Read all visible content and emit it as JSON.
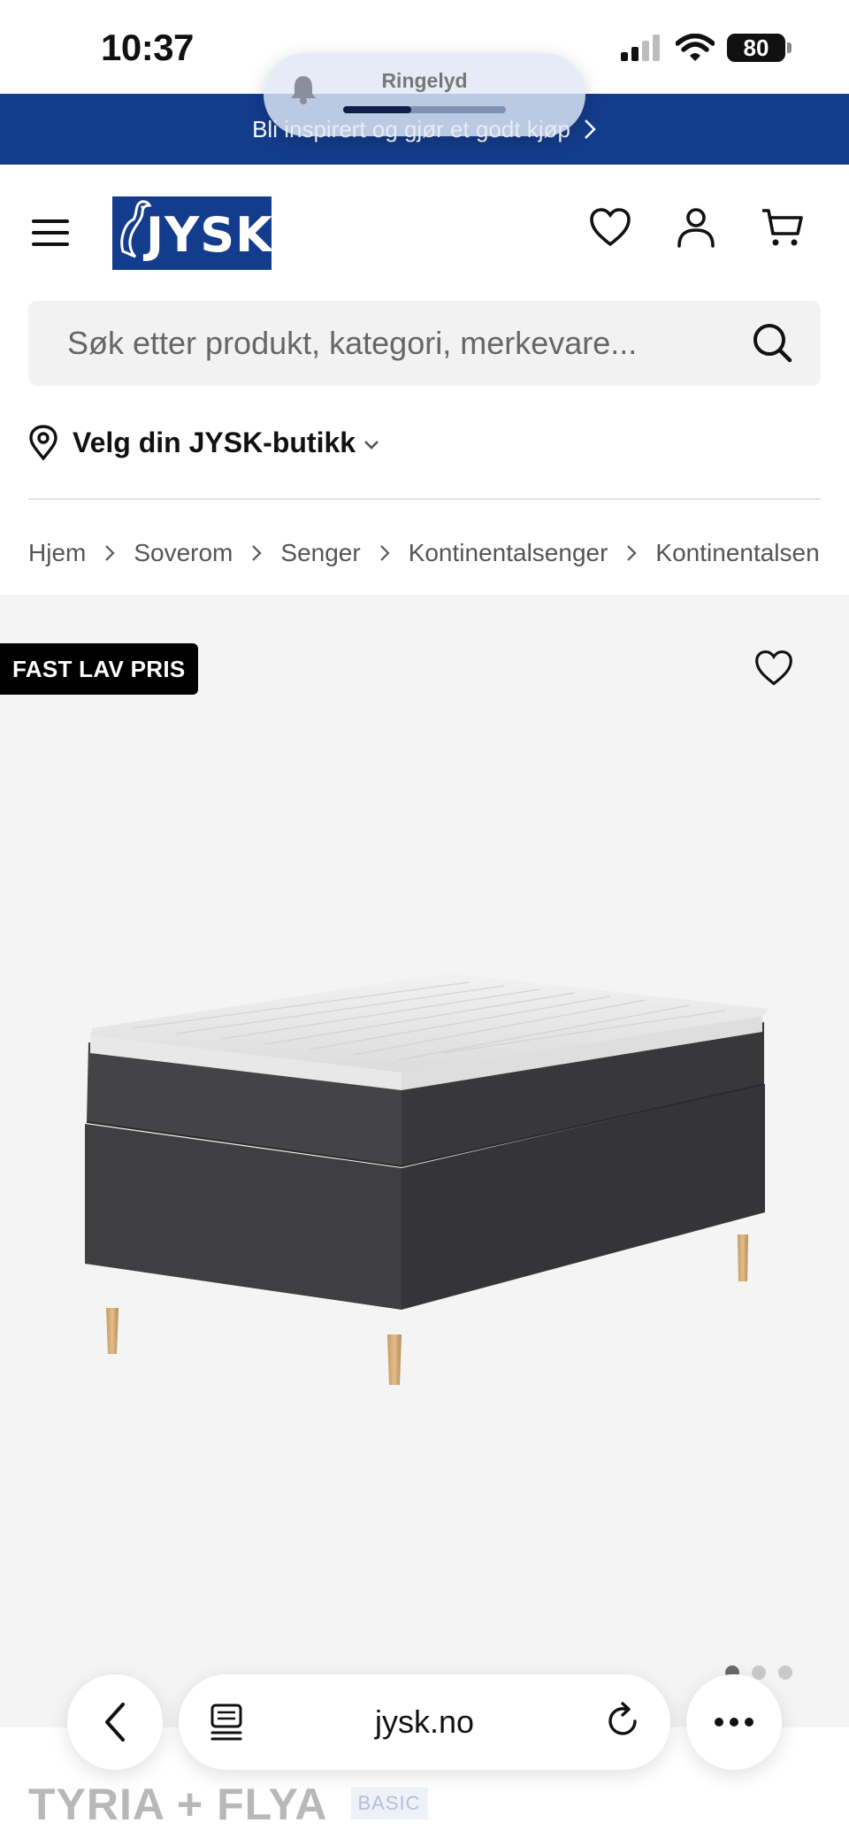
{
  "status_bar": {
    "time": "10:37",
    "battery": "80"
  },
  "promo": {
    "text": "Bli inspirert og gjør et godt kjøp"
  },
  "ringer": {
    "label": "Ringelyd",
    "level": 0.42
  },
  "header": {
    "logo_text": "JYSK"
  },
  "search": {
    "placeholder": "Søk etter produkt, kategori, merkevare..."
  },
  "store": {
    "label": "Velg din JYSK-butikk"
  },
  "breadcrumb": [
    "Hjem",
    "Soverom",
    "Senger",
    "Kontinentalsenger",
    "Kontinentalsen"
  ],
  "product": {
    "badge": "FAST LAV PRIS",
    "title": "TYRIA + FLYA",
    "tag": "BASIC",
    "image_count": 3,
    "active_image": 1
  },
  "browser": {
    "url": "jysk.no"
  },
  "icons": {
    "menu": "hamburger-icon",
    "wishlist": "heart-icon",
    "account": "user-icon",
    "cart": "cart-icon",
    "search": "search-icon",
    "location": "location-pin-icon",
    "back": "chevron-left-icon",
    "reader": "reader-icon",
    "reload": "reload-icon",
    "more": "more-icon"
  },
  "colors": {
    "brand_blue": "#143c8c",
    "badge_black": "#000000",
    "product_bg": "#f4f4f4"
  }
}
